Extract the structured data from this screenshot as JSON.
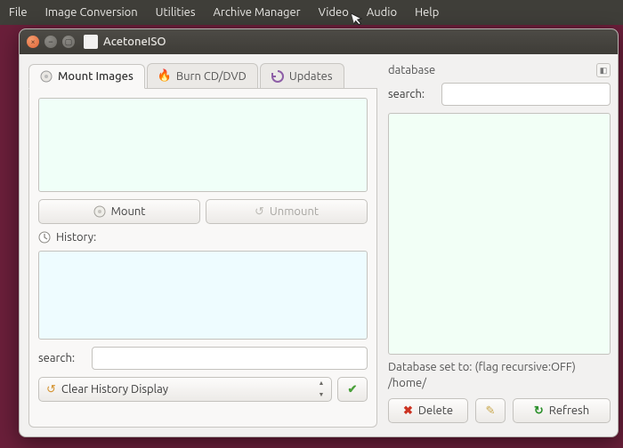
{
  "menubar": {
    "items": [
      "File",
      "Image Conversion",
      "Utilities",
      "Archive Manager",
      "Video",
      "Audio",
      "Help"
    ]
  },
  "window": {
    "title": "AcetoneISO"
  },
  "tabs": {
    "mount": "Mount Images",
    "burn": "Burn CD/DVD",
    "updates": "Updates"
  },
  "left": {
    "mount_btn": "Mount",
    "unmount_btn": "Unmount",
    "history_label": "History:",
    "search_label": "search:",
    "search_value": "",
    "combo_value": "Clear History Display"
  },
  "right": {
    "header": "database",
    "search_label": "search:",
    "search_value": "",
    "db_status_line1": "Database set to:  (flag recursive:OFF)",
    "db_status_line2": "/home/",
    "delete_btn": "Delete",
    "refresh_btn": "Refresh"
  }
}
